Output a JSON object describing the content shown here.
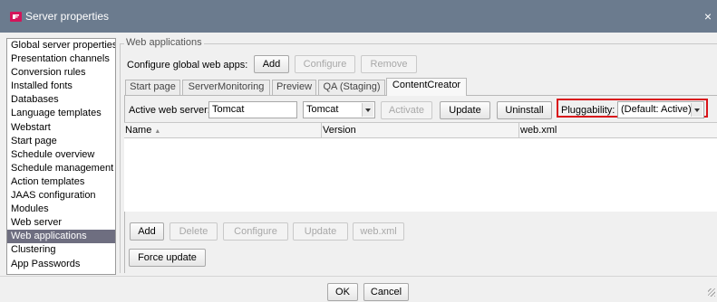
{
  "window": {
    "title": "Server properties",
    "close_label": "×"
  },
  "nav": {
    "items": [
      "Global server properties",
      "Presentation channels",
      "Conversion rules",
      "Installed fonts",
      "Databases",
      "Language templates",
      "Webstart",
      "Start page",
      "Schedule overview",
      "Schedule management",
      "Action templates",
      "JAAS configuration",
      "Modules",
      "Web server",
      "Web applications",
      "Clustering",
      "App Passwords"
    ],
    "selected": "Web applications"
  },
  "group": {
    "title": "Web applications"
  },
  "global": {
    "label": "Configure global web apps:",
    "add": "Add",
    "configure": "Configure",
    "remove": "Remove"
  },
  "tabs": {
    "items": [
      "Start page",
      "ServerMonitoring",
      "Preview",
      "QA (Staging)",
      "ContentCreator"
    ],
    "active": "ContentCreator"
  },
  "server": {
    "label": "Active web server:",
    "value": "Tomcat",
    "combo_value": "Tomcat",
    "activate": "Activate",
    "update": "Update",
    "uninstall": "Uninstall",
    "pluggability_label": "Pluggability:",
    "pluggability_value": "(Default: Active)",
    "highlight_color": "#d9141a"
  },
  "table": {
    "columns": [
      "Name",
      "Version",
      "web.xml"
    ],
    "sort_indicator": "▲",
    "rows": []
  },
  "actions": {
    "add": "Add",
    "delete": "Delete",
    "configure": "Configure",
    "update": "Update",
    "webxml": "web.xml",
    "force_update": "Force update"
  },
  "footer": {
    "ok": "OK",
    "cancel": "Cancel"
  }
}
